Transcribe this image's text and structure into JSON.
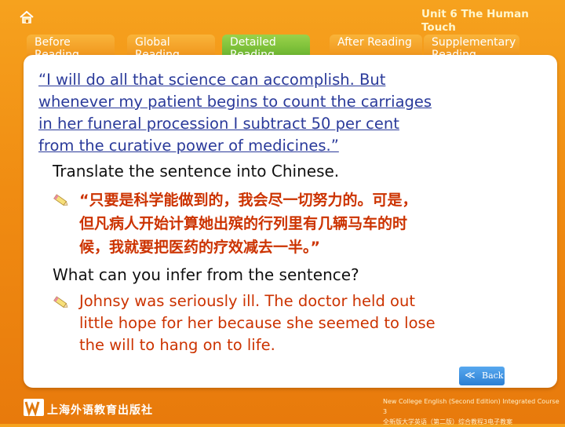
{
  "header": {
    "unit_title": "Unit 6 The Human Touch",
    "tabs": [
      {
        "label": "Before Reading",
        "active": false
      },
      {
        "label": "Global Reading",
        "active": false
      },
      {
        "label": "Detailed Reading",
        "active": true
      },
      {
        "label": "After Reading",
        "active": false
      },
      {
        "label": "Supplementary Reading",
        "active": false
      }
    ]
  },
  "main": {
    "quote": "“I will do all that science can accomplish. But\nwhenever my patient begins to count the carriages\nin her funeral procession I subtract 50 per cent\nfrom the curative power of medicines.”",
    "q1_prompt": "Translate the sentence into Chinese.",
    "q1_answer": "“只要是科学能做到的，我会尽一切努力的。可是，\n但凡病人开始计算她出殡的行列里有几辆马车的时\n候，我就要把医药的疗效减去一半。”",
    "q2_prompt": "What can you infer from the sentence?",
    "q2_answer": "Johnsy was seriously ill. The doctor held out\nlittle hope for her because she seemed to lose\nthe will to hang on to life.",
    "bullet_icon": "pencil-icon"
  },
  "nav": {
    "back_label": "Back",
    "back_icon": "double-chevron-left-icon"
  },
  "footer": {
    "publisher": "上海外语教育出版社",
    "course_en": "New College English (Second Edition) Integrated Course 3",
    "course_cn": "全新版大学英语（第二版）综合教程3电子教案"
  },
  "colors": {
    "background": "#f08c12",
    "active_tab": "#6db832",
    "quote_text": "#2a3a9a",
    "answer_text": "#cc3300",
    "back_button": "#3a8fe0"
  }
}
